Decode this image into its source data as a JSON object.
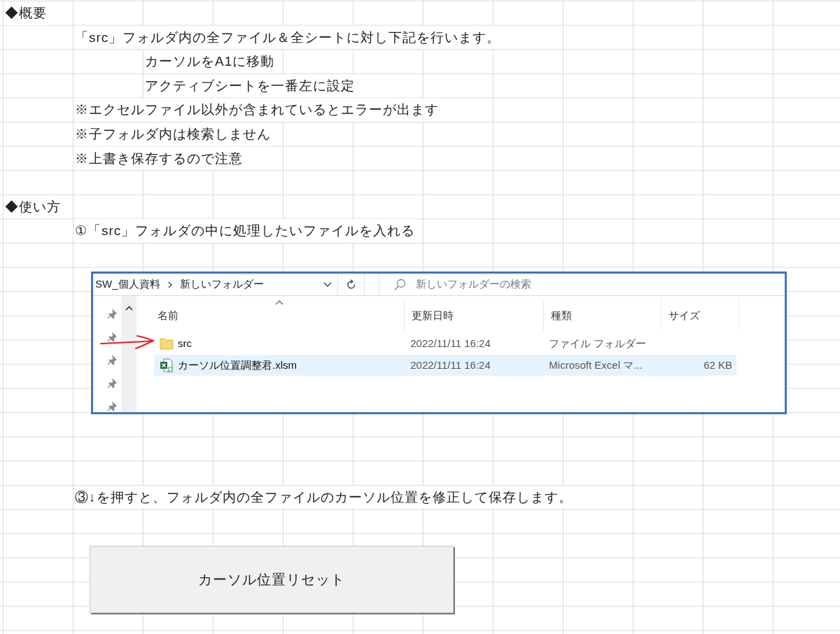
{
  "overview": {
    "heading": "◆概要",
    "items": [
      {
        "kind": "text",
        "text": "「src」フォルダ内の全ファイル＆全シートに対し下記を行います。"
      },
      {
        "kind": "sub",
        "text": "カーソルをA1に移動"
      },
      {
        "kind": "sub",
        "text": "アクティブシートを一番左に設定"
      },
      {
        "kind": "text",
        "text": "※エクセルファイル以外が含まれているとエラーが出ます"
      },
      {
        "kind": "text",
        "text": "※子フォルダ内は検索しません"
      },
      {
        "kind": "text",
        "text": "※上書き保存するので注意"
      }
    ]
  },
  "usage": {
    "heading": "◆使い方",
    "step1": "①「src」フォルダの中に処理したいファイルを入れる",
    "step3": "③↓を押すと、フォルダ内の全ファイルのカーソル位置を修正して保存します。"
  },
  "explorer": {
    "breadcrumb": [
      "SW_個人資料",
      "新しいフォルダー"
    ],
    "search": {
      "placeholder": "新しいフォルダーの検索"
    },
    "columns": [
      "名前",
      "更新日時",
      "種類",
      "サイズ"
    ],
    "files": [
      {
        "kind": "folder",
        "name": "src",
        "modified": "2022/11/11 16:24",
        "type": "ファイル フォルダー",
        "selected": false
      },
      {
        "kind": "excel",
        "name": "カーソル位置調整君.xlsm",
        "modified": "2022/11/11 16:24",
        "type": "Microsoft Excel マ...",
        "size": "62 KB",
        "selected": true
      }
    ]
  },
  "reset_button": "カーソル位置リセット"
}
